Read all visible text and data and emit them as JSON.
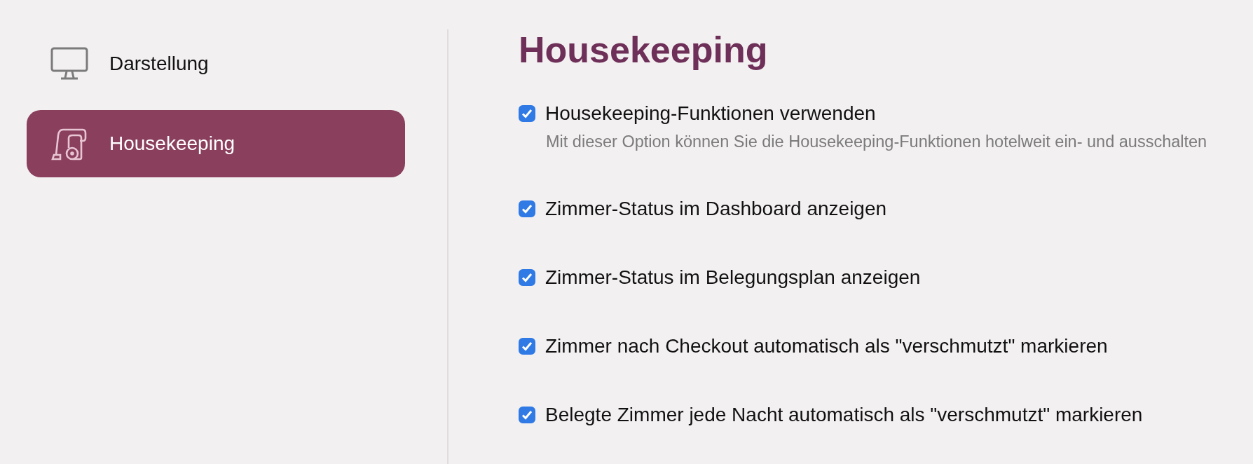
{
  "sidebar": {
    "items": [
      {
        "label": "Darstellung",
        "kind": "monitor",
        "selected": false
      },
      {
        "label": "Housekeeping",
        "kind": "vacuum",
        "selected": true
      }
    ]
  },
  "heading": "Housekeeping",
  "options": [
    {
      "label": "Housekeeping-Funktionen verwenden",
      "checked": true,
      "description": "Mit dieser Option können Sie die Housekeeping-Funktionen hotelweit ein- und ausschalten"
    },
    {
      "label": "Zimmer-Status im Dashboard anzeigen",
      "checked": true
    },
    {
      "label": "Zimmer-Status im Belegungsplan anzeigen",
      "checked": true
    },
    {
      "label": "Zimmer nach Checkout automatisch als \"verschmutzt\" markieren",
      "checked": true
    },
    {
      "label": "Belegte Zimmer jede Nacht automatisch als \"verschmutzt\" markieren",
      "checked": true
    }
  ]
}
